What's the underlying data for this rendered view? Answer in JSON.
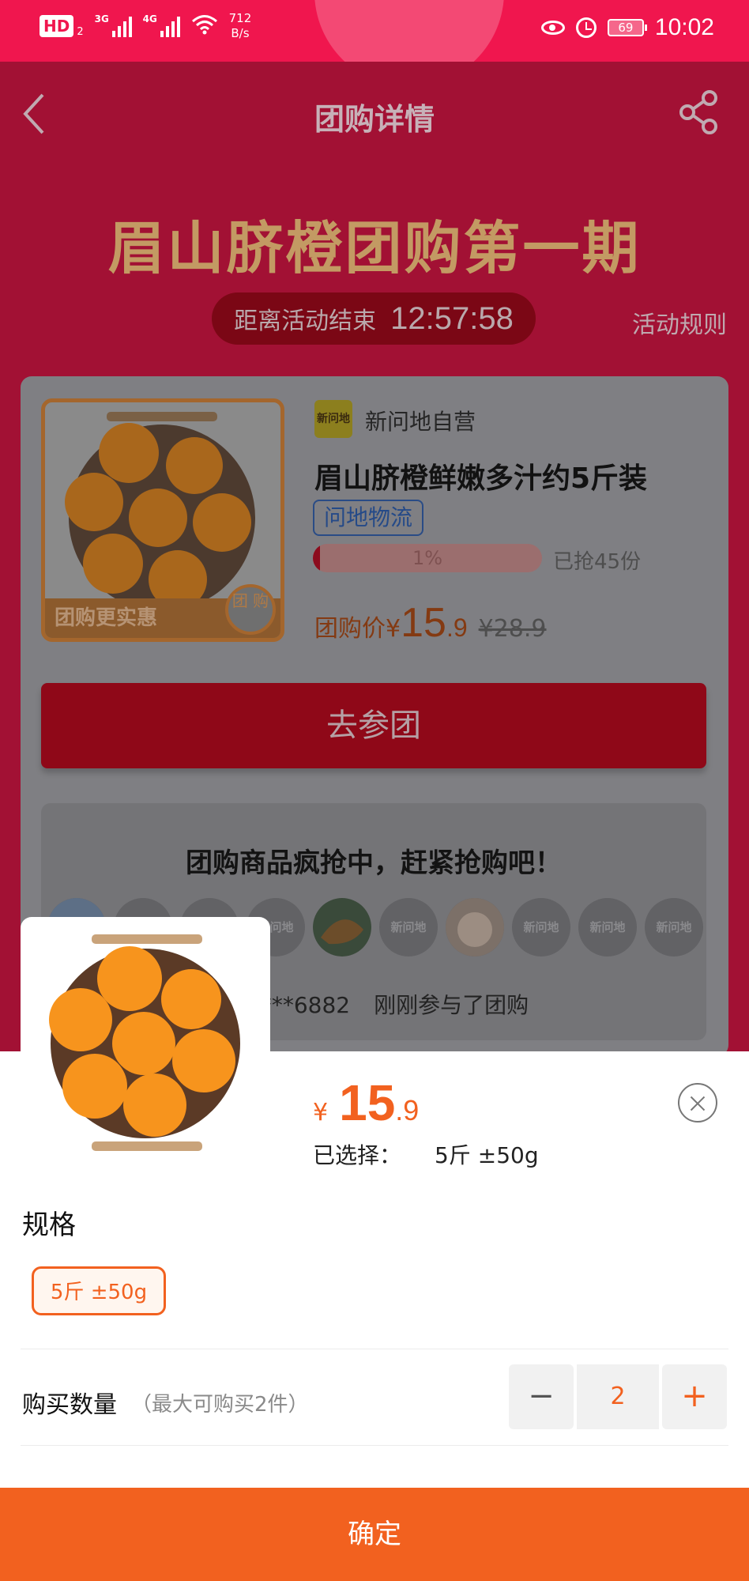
{
  "status_bar": {
    "hd_label": "HD",
    "hd_sub": "2",
    "network_1": "3G",
    "network_2": "4G",
    "speed_value": "712",
    "speed_unit": "B/s",
    "battery": "69",
    "time": "10:02"
  },
  "nav": {
    "title": "团购详情",
    "back_icon": "chevron-left-icon",
    "share_icon": "share-icon"
  },
  "hero": {
    "title": "眉山脐橙团购第一期",
    "countdown_label": "距离活动结束",
    "countdown_time": "12:57:58",
    "rules_link": "活动规则"
  },
  "product": {
    "thumb_tag": "团购更实惠",
    "thumb_seal": "团 购",
    "store_logo_text": "新问地",
    "store_name": "新问地自营",
    "name": "眉山脐橙鲜嫩多汁约5斤装",
    "logistics_tag": "问地物流",
    "progress_percent": 1,
    "progress_label": "1%",
    "sold_text": "已抢45份",
    "price_label": "团购价¥",
    "price_integer": "15",
    "price_decimal": ".9",
    "original_price": "¥28.9",
    "join_button": "去参团"
  },
  "activity": {
    "title": "团购商品疯抢中，赶紧抢购吧！",
    "avatar_placeholder": "新问地",
    "feed_user": "6****6882",
    "feed_action": "刚刚参与了团购"
  },
  "sheet": {
    "currency": "¥",
    "price_integer": "15",
    "price_decimal": ".9",
    "selected_label": "已选择：",
    "selected_value": "5斤 ±50g",
    "close_icon": "close-icon",
    "spec_label": "规格",
    "spec_option": "5斤 ±50g",
    "quantity_label": "购买数量",
    "quantity_hint": "（最大可购买2件）",
    "quantity_minus": "−",
    "quantity_value": "2",
    "quantity_plus": "+",
    "confirm_button": "确定"
  },
  "colors": {
    "status_bar": "#f0164e",
    "accent_orange": "#f2611f",
    "page_background": "#a21134"
  }
}
